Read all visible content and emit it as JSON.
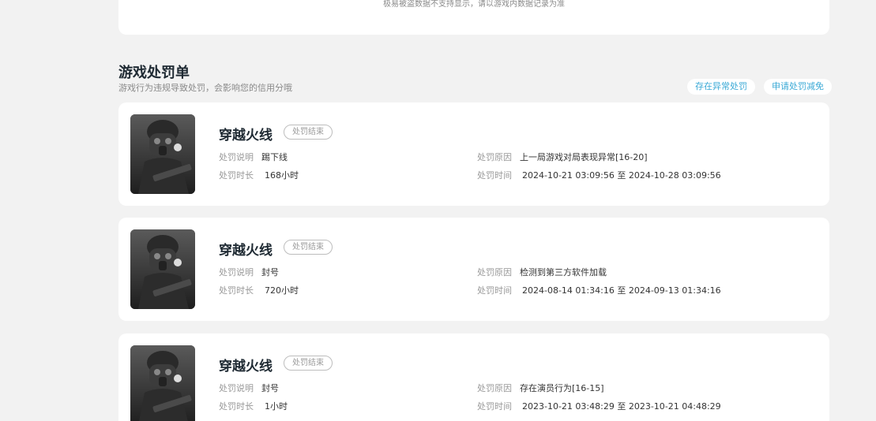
{
  "top_notice": "极易被盗数据不支持显示，请以游戏内数据记录为准",
  "section": {
    "title": "游戏处罚单",
    "subtitle": "游戏行为违规导致处罚，会影响您的信用分哦",
    "btn_abnormal": "存在异常处罚",
    "btn_reduce": "申请处罚减免"
  },
  "labels": {
    "desc": "处罚说明",
    "duration": "处罚时长",
    "reason": "处罚原因",
    "time": "处罚时间"
  },
  "records": [
    {
      "game": "穿越火线",
      "status": "处罚结束",
      "desc": "踢下线",
      "duration": "168小时",
      "reason": "上一局游戏对局表现异常[16-20]",
      "time": "2024-10-21 03:09:56 至 2024-10-28 03:09:56"
    },
    {
      "game": "穿越火线",
      "status": "处罚结束",
      "desc": "封号",
      "duration": "720小时",
      "reason": "检测到第三方软件加载",
      "time": "2024-08-14 01:34:16 至 2024-09-13 01:34:16"
    },
    {
      "game": "穿越火线",
      "status": "处罚结束",
      "desc": "封号",
      "duration": "1小时",
      "reason": "存在演员行为[16-15]",
      "time": "2023-10-21 03:48:29 至 2023-10-21 04:48:29"
    }
  ]
}
